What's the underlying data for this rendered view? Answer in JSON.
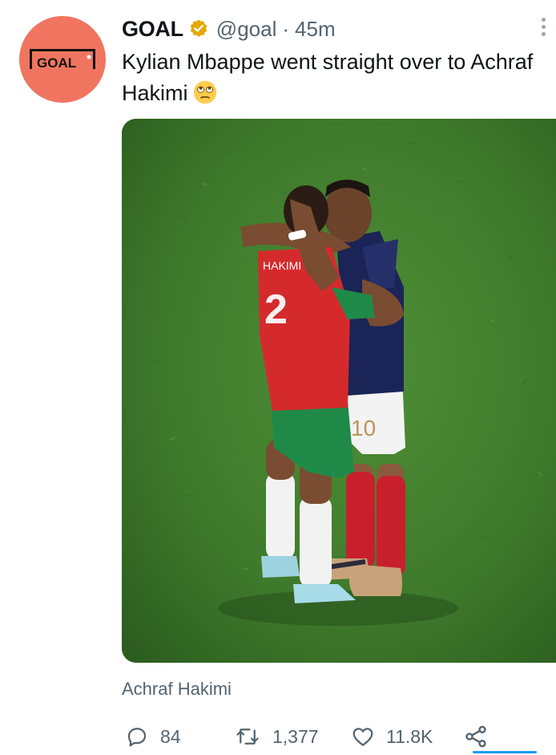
{
  "tweet": {
    "display_name": "GOAL",
    "handle": "@goal",
    "separator": "·",
    "time": "45m",
    "text": "Kylian Mbappe went straight over to Achraf Hakimi",
    "avatar_logo_text": "GOAL",
    "media_alt": "Mbappe embracing Hakimi on the pitch",
    "tagged_user": "Achraf Hakimi"
  },
  "actions": {
    "replies": "84",
    "retweets": "1,377",
    "likes": "11.8K"
  },
  "icons": {
    "verified": "verified-badge-icon",
    "more": "more-options-icon",
    "emoji": "face-with-rolling-eyes-emoji",
    "reply": "reply-icon",
    "retweet": "retweet-icon",
    "like": "heart-icon",
    "share": "share-icon"
  },
  "colors": {
    "avatar_bg": "#f07560",
    "verified": "#e5a700",
    "muted": "#536471",
    "text": "#0f1419",
    "pitch": "#3f7a2c"
  }
}
